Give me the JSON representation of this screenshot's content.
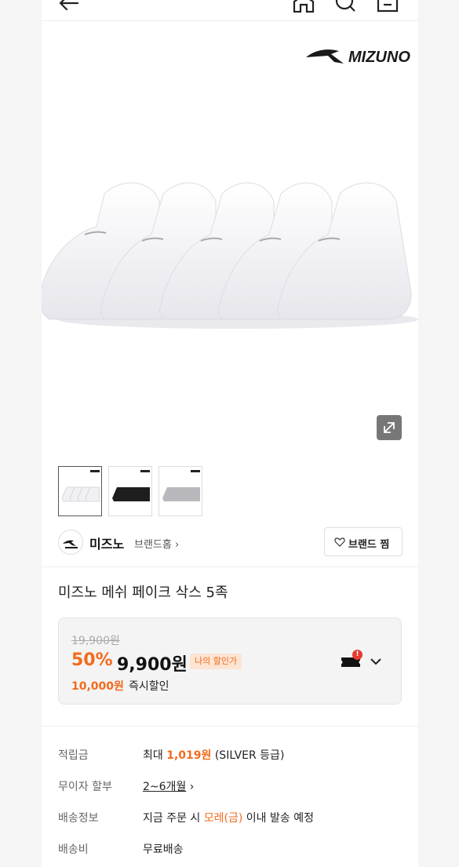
{
  "header": {
    "back_icon": "arrow-left-icon",
    "home_icon": "home-icon",
    "search_icon": "search-icon",
    "cart_icon": "shopping-bag-icon"
  },
  "hero": {
    "brand_logo_text": "MIZUNO",
    "expand_icon": "expand-icon"
  },
  "thumbnails": [
    {
      "color": "white"
    },
    {
      "color": "black"
    },
    {
      "color": "gray"
    }
  ],
  "brand": {
    "name": "미즈노",
    "home_link": "브랜드홈",
    "fav_label": "브랜드 찜"
  },
  "product": {
    "title": "미즈노 메쉬 페이크 삭스 5족"
  },
  "price": {
    "original": "19,900원",
    "discount_rate": "50%",
    "final": "9,900원",
    "my_price_badge": "나의 할인가",
    "instant_amount": "10,000원",
    "instant_label": "즉시할인",
    "coupon_badge": "!"
  },
  "info": {
    "points": {
      "label": "적립금",
      "prefix": "최대 ",
      "amount": "1,019원",
      "suffix": " (SILVER 등급)"
    },
    "installment": {
      "label": "무이자 할부",
      "value": "2~6개월"
    },
    "shipping": {
      "label": "배송정보",
      "prefix": "지금 주문 시 ",
      "highlight": "모레(금)",
      "suffix": " 이내 발송 예정"
    },
    "fee": {
      "label": "배송비",
      "value": "무료배송"
    }
  },
  "colors": {
    "accent": "#f26b1d",
    "badge_bg": "#fde4d3",
    "alert": "#e53a2f"
  }
}
